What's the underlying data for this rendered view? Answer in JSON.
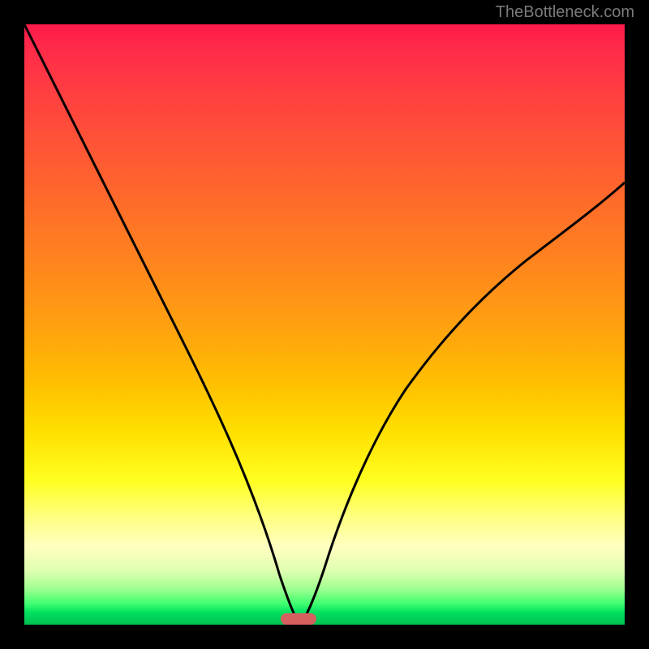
{
  "attribution": "TheBottleneck.com",
  "chart_data": {
    "type": "line",
    "title": "",
    "xlabel": "",
    "ylabel": "",
    "x_range": [
      0,
      100
    ],
    "y_range": [
      0,
      100
    ],
    "series": [
      {
        "name": "bottleneck-curve",
        "description": "V-shaped curve with minimum near x≈46; left branch starts at top-left, right branch rises to about 74% height on the right edge",
        "x": [
          0,
          5,
          10,
          15,
          20,
          25,
          30,
          35,
          40,
          43,
          45,
          46,
          47,
          49,
          52,
          56,
          60,
          65,
          70,
          75,
          80,
          85,
          90,
          95,
          100
        ],
        "y": [
          100,
          92,
          84,
          76,
          67,
          58,
          48,
          37,
          24,
          13,
          5,
          1,
          4,
          12,
          22,
          32,
          40,
          48,
          54,
          59,
          63,
          66.5,
          69.5,
          72,
          74
        ]
      }
    ],
    "marker": {
      "x_center": 46,
      "y": 0,
      "color": "#d66060",
      "shape": "rounded-bar"
    },
    "background_gradient": {
      "orientation": "vertical",
      "stops": [
        {
          "pos": 0.0,
          "color": "#ff1a4a"
        },
        {
          "pos": 0.25,
          "color": "#ff6030"
        },
        {
          "pos": 0.5,
          "color": "#ffa010"
        },
        {
          "pos": 0.76,
          "color": "#ffff20"
        },
        {
          "pos": 0.91,
          "color": "#e0ffb0"
        },
        {
          "pos": 1.0,
          "color": "#00c050"
        }
      ]
    }
  }
}
